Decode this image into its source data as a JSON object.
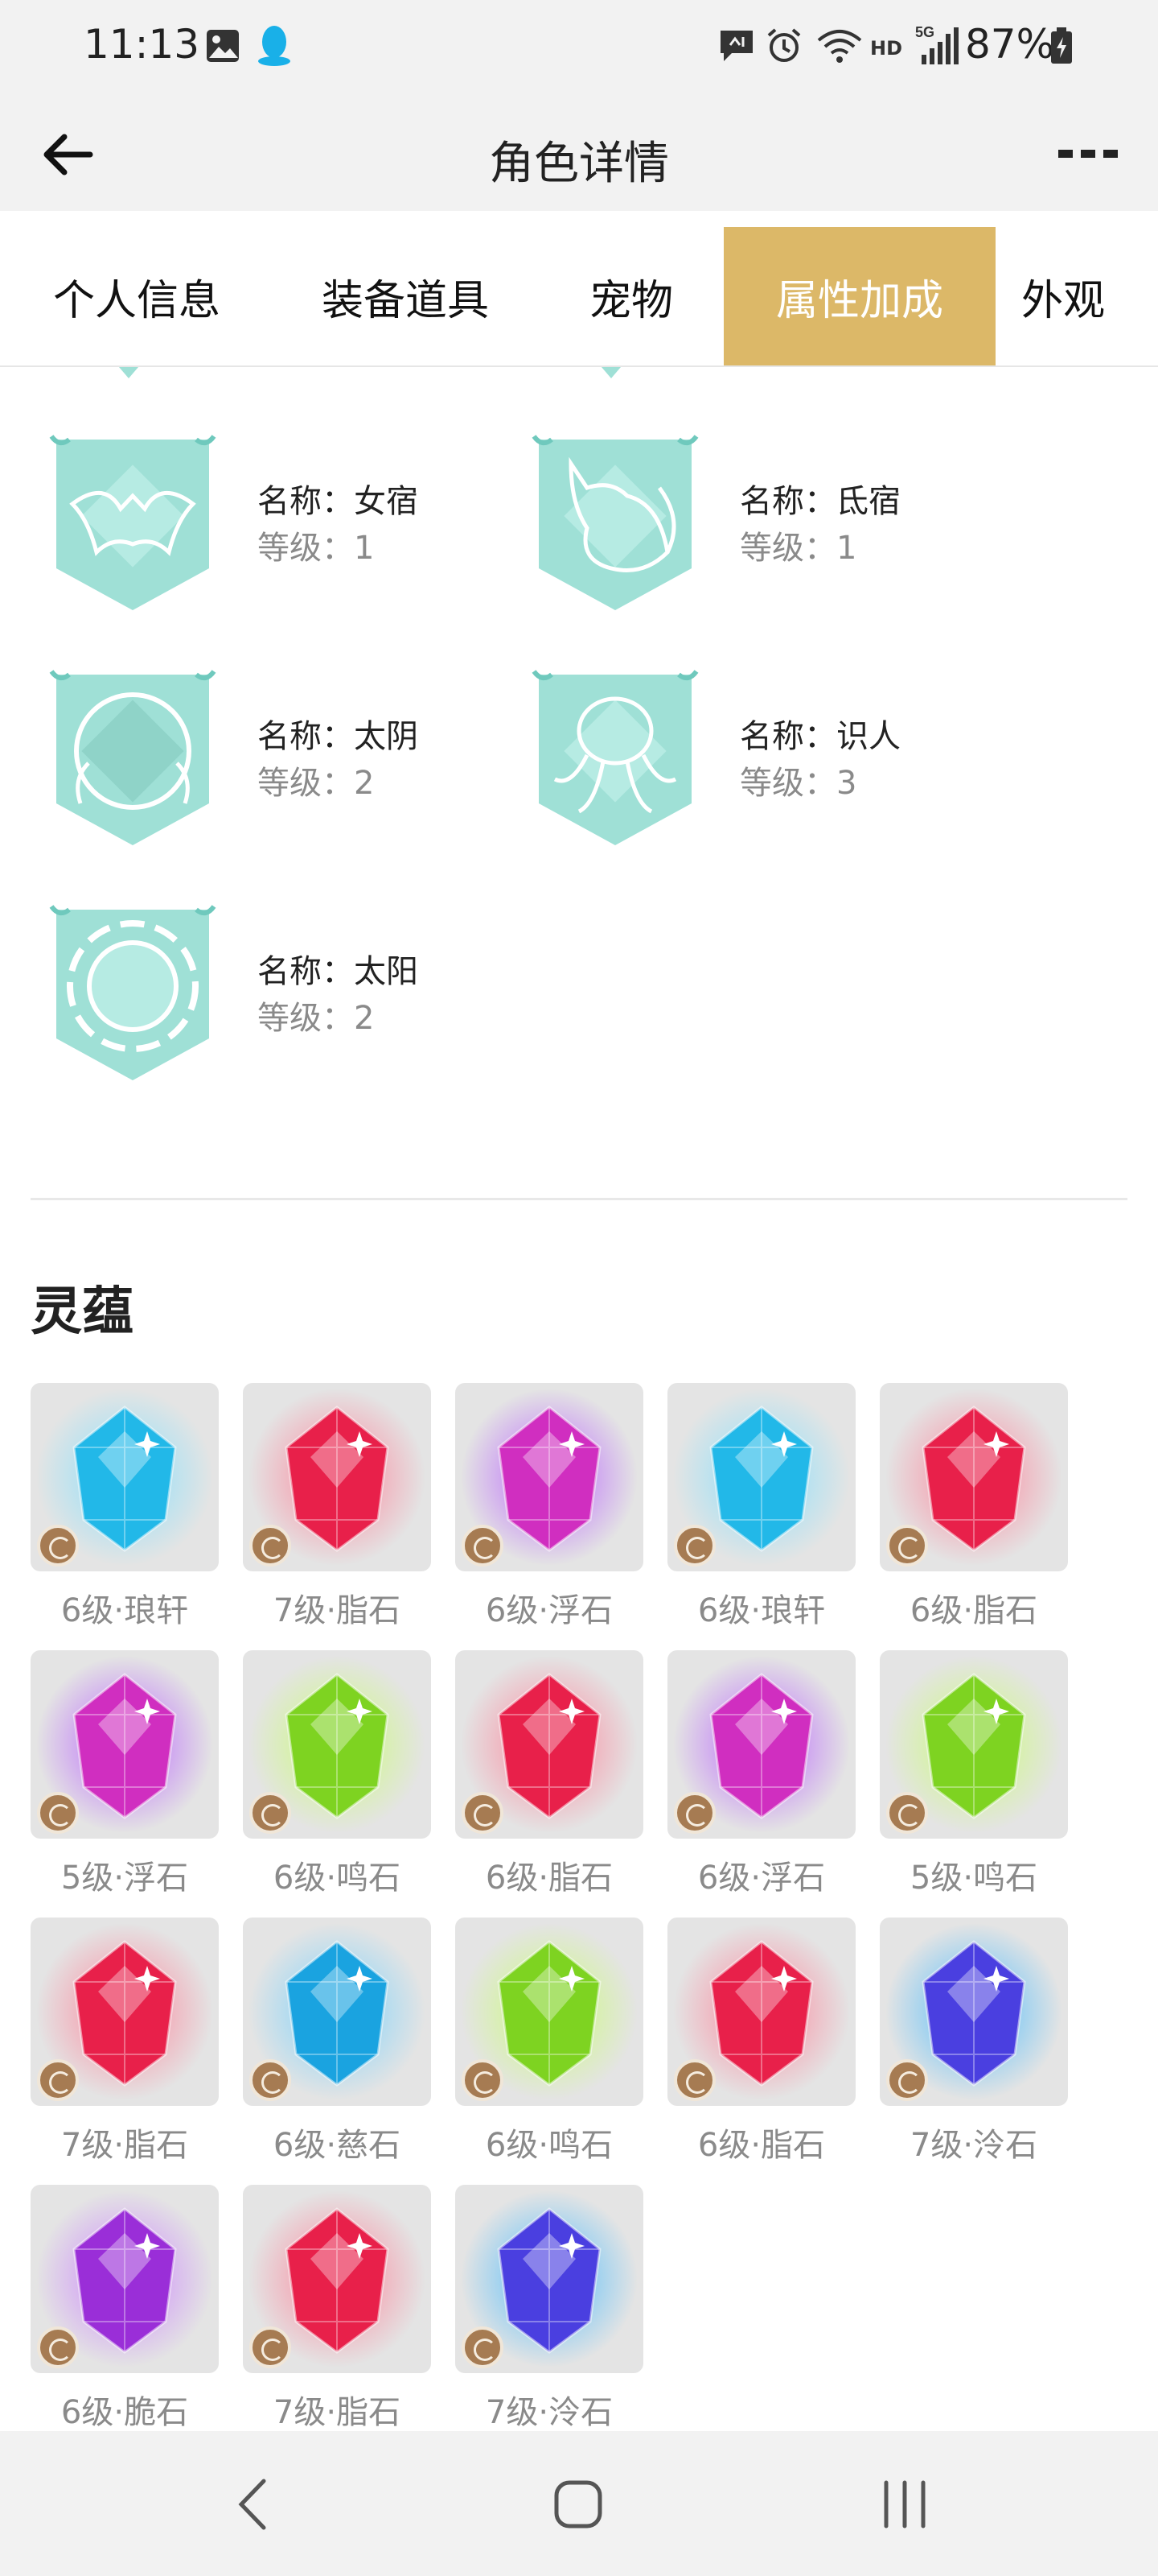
{
  "status_bar": {
    "time": "11:13",
    "battery": "87%",
    "network": "5G",
    "hd": "HD"
  },
  "app_bar": {
    "title": "角色详情"
  },
  "tabs": [
    {
      "label": "个人信息",
      "active": false
    },
    {
      "label": "装备道具",
      "active": false
    },
    {
      "label": "宠物",
      "active": false
    },
    {
      "label": "属性加成",
      "active": true
    },
    {
      "label": "外观",
      "active": false
    }
  ],
  "constellations": [
    {
      "name": "名称：女宿",
      "level": "等级：1",
      "icon": "bat-emblem-icon"
    },
    {
      "name": "名称：氐宿",
      "level": "等级：1",
      "icon": "fox-emblem-icon"
    },
    {
      "name": "名称：太阴",
      "level": "等级：2",
      "icon": "moon-emblem-icon"
    },
    {
      "name": "名称：识人",
      "level": "等级：3",
      "icon": "octopus-emblem-icon"
    },
    {
      "name": "名称：太阳",
      "level": "等级：2",
      "icon": "sun-emblem-icon"
    }
  ],
  "section": {
    "title": "灵蕴"
  },
  "gems": [
    {
      "label": "6级·琅轩",
      "color": "#22b8e8",
      "glow": "#7fe0ff"
    },
    {
      "label": "7级·脂石",
      "color": "#e8204a",
      "glow": "#ff7a92"
    },
    {
      "label": "6级·浮石",
      "color": "#d02ec0",
      "glow": "#b455ff"
    },
    {
      "label": "6级·琅轩",
      "color": "#22b8e8",
      "glow": "#7fe0ff"
    },
    {
      "label": "6级·脂石",
      "color": "#e8204a",
      "glow": "#ff7a92"
    },
    {
      "label": "5级·浮石",
      "color": "#d02ec0",
      "glow": "#b455ff"
    },
    {
      "label": "6级·鸣石",
      "color": "#7ed321",
      "glow": "#c8ff6a"
    },
    {
      "label": "6级·脂石",
      "color": "#e8204a",
      "glow": "#ff7a92"
    },
    {
      "label": "6级·浮石",
      "color": "#d02ec0",
      "glow": "#b455ff"
    },
    {
      "label": "5级·鸣石",
      "color": "#7ed321",
      "glow": "#c8ff6a"
    },
    {
      "label": "7级·脂石",
      "color": "#e8204a",
      "glow": "#ff7a92"
    },
    {
      "label": "6级·慈石",
      "color": "#1aa3e0",
      "glow": "#6fd0ff"
    },
    {
      "label": "6级·鸣石",
      "color": "#7ed321",
      "glow": "#c8ff6a"
    },
    {
      "label": "6级·脂石",
      "color": "#e8204a",
      "glow": "#ff7a92"
    },
    {
      "label": "7级·泠石",
      "color": "#4a3fe0",
      "glow": "#3fb8ff"
    },
    {
      "label": "6级·脆石",
      "color": "#9a2ed8",
      "glow": "#c87aff"
    },
    {
      "label": "7级·脂石",
      "color": "#e8204a",
      "glow": "#ff7a92"
    },
    {
      "label": "7级·泠石",
      "color": "#4a3fe0",
      "glow": "#3fb8ff"
    }
  ],
  "colors": {
    "accent": "#dcb868",
    "emblem": "#9fe0d6",
    "muted_text": "#8a8a8a"
  }
}
